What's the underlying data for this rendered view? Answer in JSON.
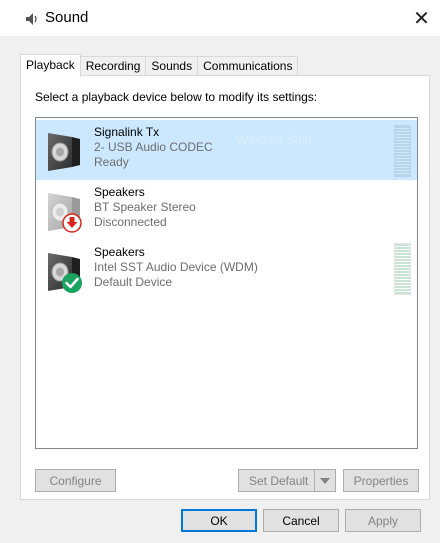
{
  "window": {
    "title": "Sound",
    "icon": "speaker-icon",
    "close_glyph": "✕"
  },
  "tabs": [
    {
      "label": "Playback",
      "active": true
    },
    {
      "label": "Recording",
      "active": false
    },
    {
      "label": "Sounds",
      "active": false
    },
    {
      "label": "Communications",
      "active": false
    }
  ],
  "instruction": "Select a playback device below to modify its settings:",
  "devices": [
    {
      "name": "Signalink Tx",
      "subtitle": "2- USB Audio CODEC",
      "status": "Ready",
      "selected": true,
      "badge": "none"
    },
    {
      "name": "Speakers",
      "subtitle": "BT Speaker Stereo",
      "status": "Disconnected",
      "selected": false,
      "badge": "red-down-arrow"
    },
    {
      "name": "Speakers",
      "subtitle": "Intel SST Audio Device (WDM)",
      "status": "Default Device",
      "selected": false,
      "badge": "green-check"
    }
  ],
  "watermark": "Window Snip",
  "buttons": {
    "configure": "Configure",
    "set_default": "Set Default",
    "properties": "Properties",
    "ok": "OK",
    "cancel": "Cancel",
    "apply": "Apply"
  },
  "colors": {
    "selection": "#cce8ff",
    "accent": "#0078d7",
    "check": "#1aa260",
    "warning_arrow": "#d9261c"
  }
}
